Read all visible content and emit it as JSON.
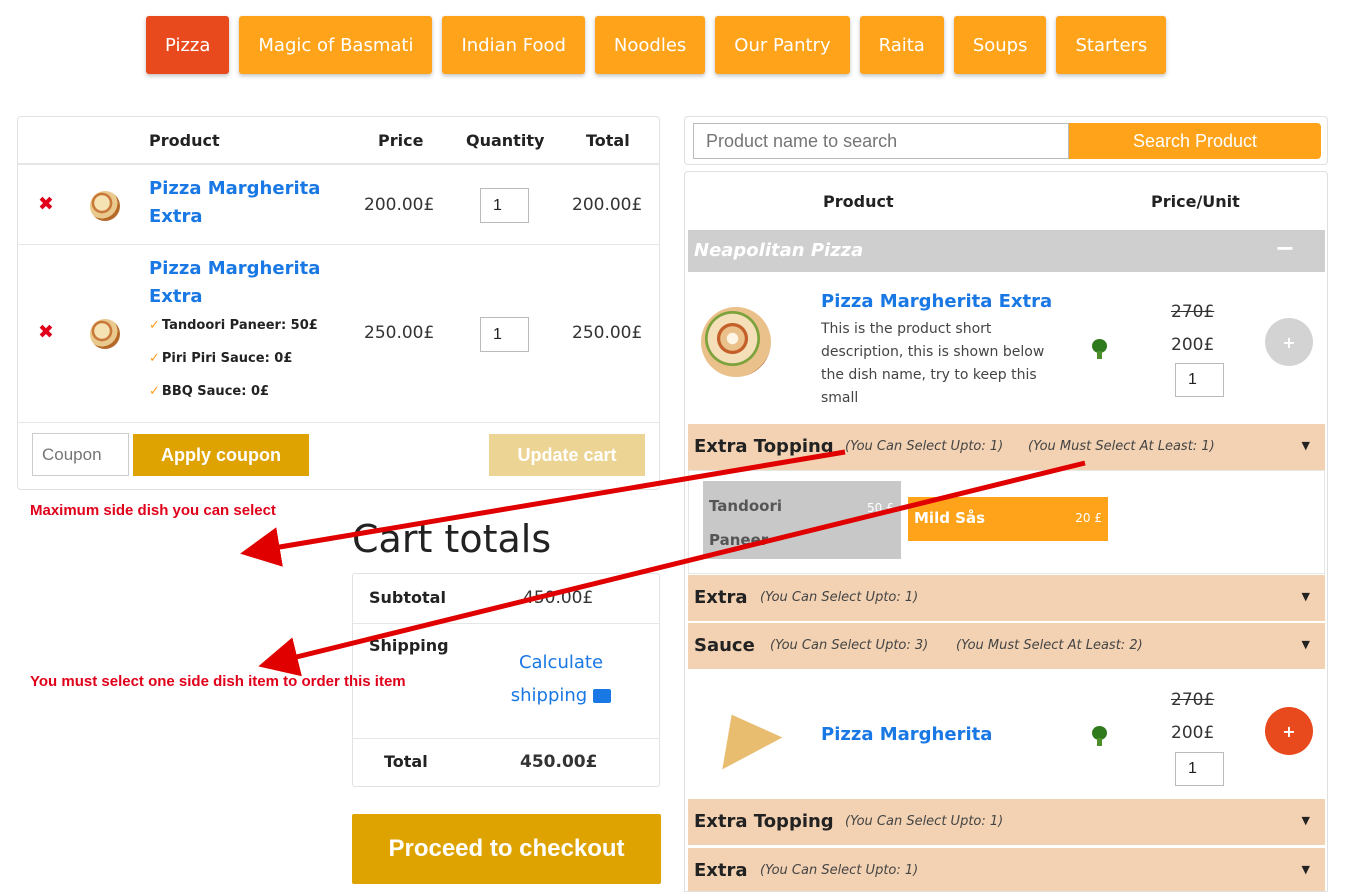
{
  "tabs": [
    {
      "label": "Pizza"
    },
    {
      "label": "Magic of Basmati"
    },
    {
      "label": "Indian Food"
    },
    {
      "label": "Noodles"
    },
    {
      "label": "Our Pantry"
    },
    {
      "label": "Raita"
    },
    {
      "label": "Soups"
    },
    {
      "label": "Starters"
    }
  ],
  "cart": {
    "headers": {
      "product": "Product",
      "price": "Price",
      "quantity": "Quantity",
      "total": "Total"
    },
    "remove_icon": "✖",
    "items": [
      {
        "name_line1": "Pizza Margherita",
        "name_line2": "Extra",
        "price": "200.00£",
        "quantity": "1",
        "total": "200.00£"
      },
      {
        "name_line1": "Pizza Margherita",
        "name_line2": "Extra",
        "price": "250.00£",
        "quantity": "1",
        "total": "250.00£",
        "options": [
          {
            "check": "✓",
            "label": "Tandoori Paneer: 50£"
          },
          {
            "check": "✓",
            "label": "Piri Piri Sauce: 0£"
          },
          {
            "check": "✓",
            "label": "BBQ Sauce: 0£"
          }
        ]
      }
    ],
    "coupon_placeholder": "Coupon",
    "apply_label": "Apply coupon",
    "update_label": "Update cart"
  },
  "annotations": {
    "note1": "Maximum side dish you can select",
    "note2": "You must select one side dish item to order this item"
  },
  "totals": {
    "title": "Cart totals",
    "subtotal_label": "Subtotal",
    "subtotal_value": "450.00£",
    "shipping_label": "Shipping",
    "calc_line1": "Calculate",
    "calc_line2": "shipping",
    "total_label": "Total",
    "total_value": "450.00£",
    "checkout_label": "Proceed to checkout"
  },
  "search": {
    "placeholder": "Product name to search",
    "button": "Search Product"
  },
  "menu": {
    "headers": {
      "product": "Product",
      "price": "Price/Unit"
    },
    "category": {
      "name": "Neapolitan Pizza",
      "toggle": "−"
    },
    "products": [
      {
        "name": "Pizza Margherita Extra",
        "description": "This is the product short description, this is shown below the dish name, try to keep this small",
        "old_price": "270£",
        "price": "200£",
        "quantity": "1",
        "add": "+"
      },
      {
        "name": "Pizza Margherita",
        "old_price": "270£",
        "price": "200£",
        "quantity": "1",
        "add": "+"
      }
    ],
    "groups1": [
      {
        "name": "Extra Topping",
        "info1": "(You Can Select Upto: 1)",
        "info2": "(You Must Select At Least: 1)",
        "caret": "▼"
      },
      {
        "name": "Extra",
        "info1": "(You Can Select Upto: 1)",
        "caret": "▼"
      },
      {
        "name": "Sauce",
        "info1": "(You Can Select Upto: 3)",
        "info2": "(You Must Select At Least: 2)",
        "caret": "▼"
      }
    ],
    "options": [
      {
        "name": "Tandoori Paneer",
        "price": "50 £"
      },
      {
        "name": "Mild Sås",
        "price": "20 £"
      }
    ],
    "groups2": [
      {
        "name": "Extra Topping",
        "info1": "(You Can Select Upto: 1)",
        "caret": "▼"
      },
      {
        "name": "Extra",
        "info1": "(You Can Select Upto: 1)",
        "caret": "▼"
      }
    ]
  },
  "colors": {
    "accent": "#ffa31a",
    "active_tab": "#e8491d",
    "link": "#1a78e5",
    "gold": "#dea300",
    "annotation": "#e0001a"
  }
}
